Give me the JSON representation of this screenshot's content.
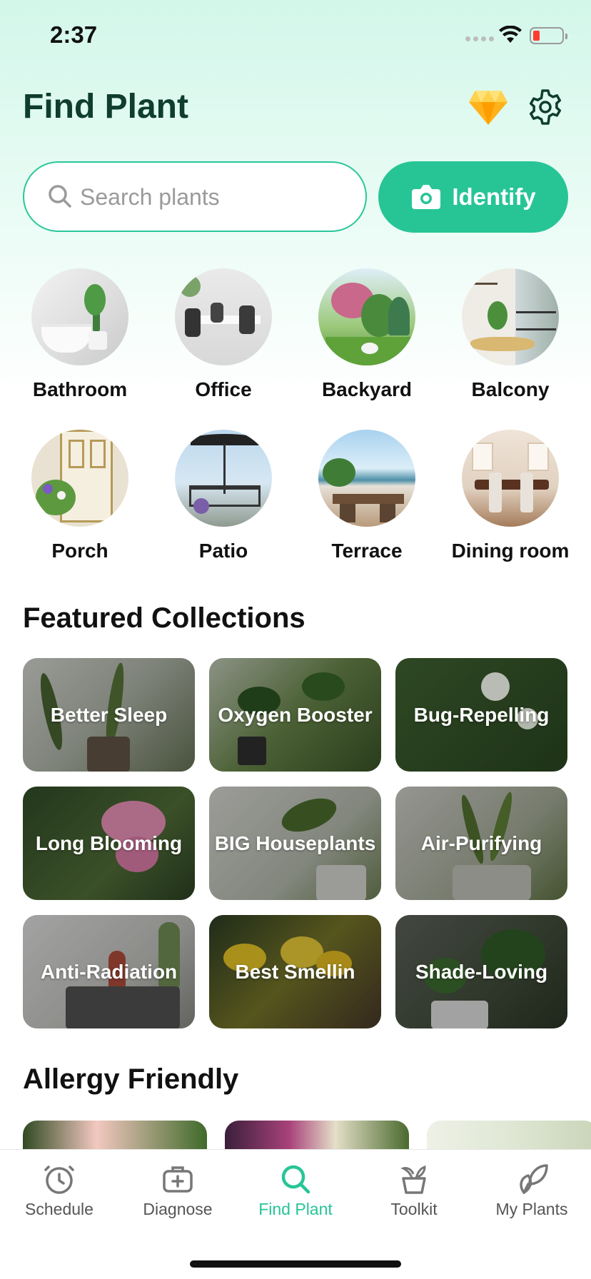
{
  "status_bar": {
    "time": "2:37"
  },
  "header": {
    "title": "Find Plant"
  },
  "search": {
    "placeholder": "Search plants",
    "identify_label": "Identify"
  },
  "rooms": [
    {
      "label": "Bathroom"
    },
    {
      "label": "Office"
    },
    {
      "label": "Backyard"
    },
    {
      "label": "Balcony"
    },
    {
      "label": "Porch"
    },
    {
      "label": "Patio"
    },
    {
      "label": "Terrace"
    },
    {
      "label": "Dining room"
    }
  ],
  "featured": {
    "title": "Featured Collections",
    "items": [
      {
        "label": "Better Sleep"
      },
      {
        "label": "Oxygen Booster"
      },
      {
        "label": "Bug-Repelling"
      },
      {
        "label": "Long Blooming"
      },
      {
        "label": "BIG Houseplants"
      },
      {
        "label": "Air-Purifying"
      },
      {
        "label": "Anti-Radiation"
      },
      {
        "label": "Best Smellin"
      },
      {
        "label": "Shade-Loving"
      }
    ]
  },
  "allergy": {
    "title": "Allergy Friendly"
  },
  "tabs": [
    {
      "label": "Schedule",
      "icon": "clock-icon"
    },
    {
      "label": "Diagnose",
      "icon": "medkit-icon"
    },
    {
      "label": "Find Plant",
      "icon": "search-icon",
      "active": true
    },
    {
      "label": "Toolkit",
      "icon": "pot-icon"
    },
    {
      "label": "My Plants",
      "icon": "leaves-icon"
    }
  ],
  "colors": {
    "accent": "#27c596",
    "title": "#0f3d2e",
    "gem": "#ffb21a"
  }
}
